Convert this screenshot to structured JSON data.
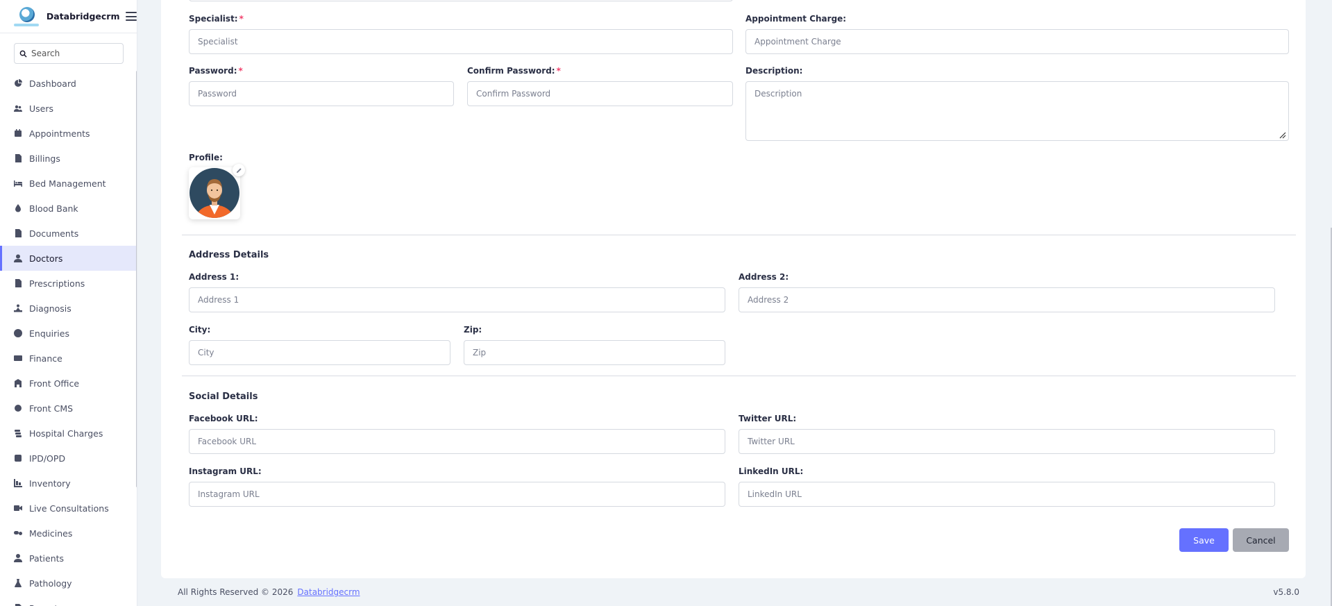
{
  "brand": {
    "name": "Databridgecrm"
  },
  "search": {
    "placeholder": "Search"
  },
  "sidebar": {
    "items": [
      {
        "label": "Dashboard",
        "icon": "dashboard-icon"
      },
      {
        "label": "Users",
        "icon": "users-icon"
      },
      {
        "label": "Appointments",
        "icon": "calendar-icon"
      },
      {
        "label": "Billings",
        "icon": "invoice-icon"
      },
      {
        "label": "Bed Management",
        "icon": "bed-icon"
      },
      {
        "label": "Blood Bank",
        "icon": "droplet-icon"
      },
      {
        "label": "Documents",
        "icon": "document-icon"
      },
      {
        "label": "Doctors",
        "icon": "doctor-icon",
        "active": true
      },
      {
        "label": "Prescriptions",
        "icon": "prescription-icon"
      },
      {
        "label": "Diagnosis",
        "icon": "diagnosis-icon"
      },
      {
        "label": "Enquiries",
        "icon": "question-icon"
      },
      {
        "label": "Finance",
        "icon": "money-icon"
      },
      {
        "label": "Front Office",
        "icon": "building-icon"
      },
      {
        "label": "Front CMS",
        "icon": "gear-icon"
      },
      {
        "label": "Hospital Charges",
        "icon": "charges-icon"
      },
      {
        "label": "IPD/OPD",
        "icon": "ipd-icon"
      },
      {
        "label": "Inventory",
        "icon": "inventory-icon"
      },
      {
        "label": "Live Consultations",
        "icon": "video-icon"
      },
      {
        "label": "Medicines",
        "icon": "pills-icon"
      },
      {
        "label": "Patients",
        "icon": "patient-icon"
      },
      {
        "label": "Pathology",
        "icon": "flask-icon"
      },
      {
        "label": "Reports",
        "icon": "report-icon"
      }
    ]
  },
  "form": {
    "specialist": {
      "label": "Specialist:",
      "placeholder": "Specialist",
      "required": "*"
    },
    "appointment_charge": {
      "label": "Appointment Charge:",
      "placeholder": "Appointment Charge"
    },
    "password": {
      "label": "Password:",
      "placeholder": "Password",
      "required": "*"
    },
    "confirm_password": {
      "label": "Confirm Password:",
      "placeholder": "Confirm Password",
      "required": "*"
    },
    "description": {
      "label": "Description:",
      "placeholder": "Description"
    },
    "profile": {
      "label": "Profile:"
    }
  },
  "address": {
    "title": "Address Details",
    "address1": {
      "label": "Address 1:",
      "placeholder": "Address 1"
    },
    "address2": {
      "label": "Address 2:",
      "placeholder": "Address 2"
    },
    "city": {
      "label": "City:",
      "placeholder": "City"
    },
    "zip": {
      "label": "Zip:",
      "placeholder": "Zip"
    }
  },
  "social": {
    "title": "Social Details",
    "facebook": {
      "label": "Facebook URL:",
      "placeholder": "Facebook URL"
    },
    "twitter": {
      "label": "Twitter URL:",
      "placeholder": "Twitter URL"
    },
    "instagram": {
      "label": "Instagram URL:",
      "placeholder": "Instagram URL"
    },
    "linkedin": {
      "label": "LinkedIn URL:",
      "placeholder": "LinkedIn URL"
    }
  },
  "actions": {
    "save": "Save",
    "cancel": "Cancel"
  },
  "footer": {
    "text": "All Rights Reserved © 2026",
    "link": "Databridgecrm",
    "version": "v5.8.0"
  },
  "colors": {
    "primary": "#6571ff",
    "required": "#f1416c",
    "cancel": "#a7aab3",
    "active_bg": "#e5e8fb"
  }
}
